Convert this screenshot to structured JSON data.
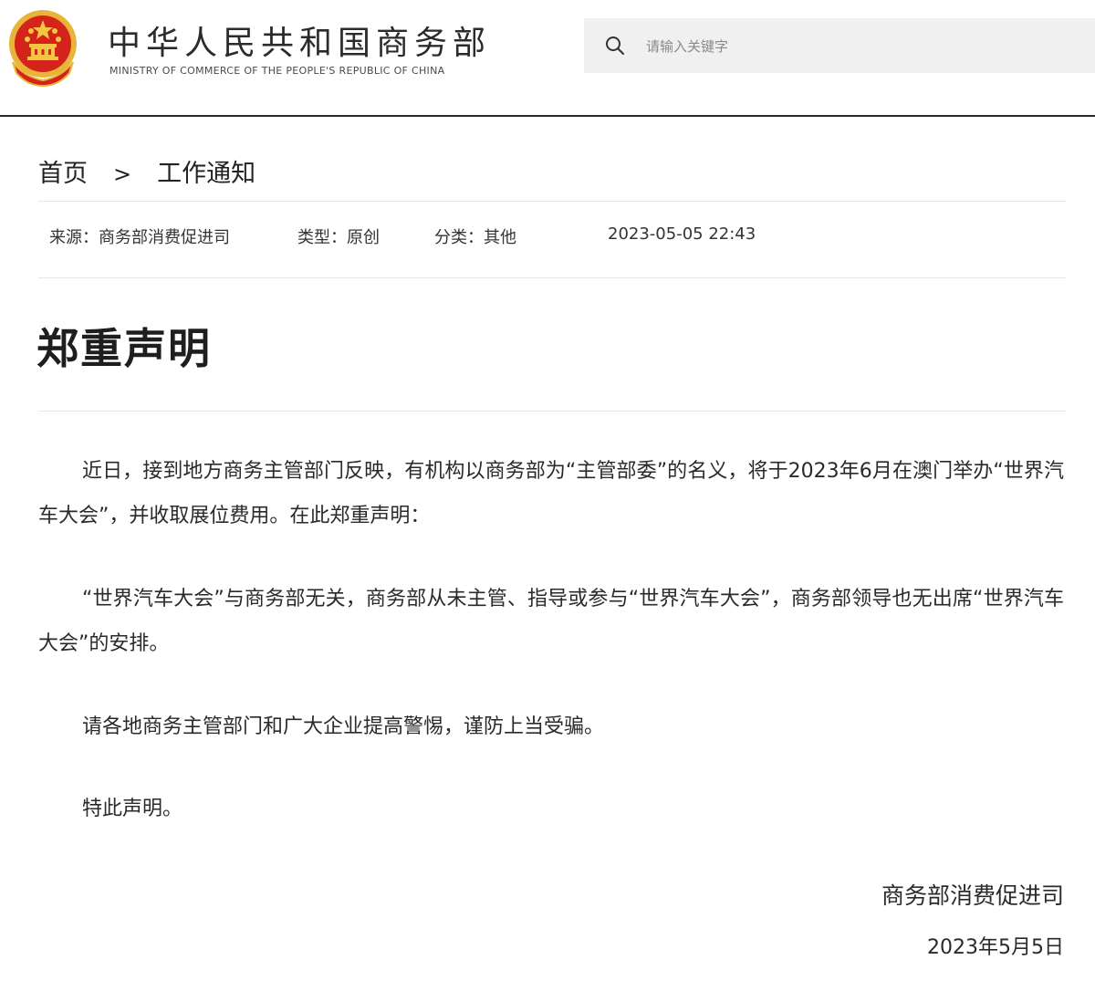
{
  "header": {
    "title": "中华人民共和国商务部",
    "subtitle": "MINISTRY OF COMMERCE OF THE PEOPLE'S REPUBLIC OF CHINA",
    "emblem_icon": "national-emblem-icon",
    "search": {
      "placeholder": "请输入关键字",
      "icon": "search-icon"
    }
  },
  "breadcrumb": {
    "home": "首页",
    "separator": ">",
    "current": "工作通知"
  },
  "meta": {
    "source": "来源：商务部消费促进司",
    "type": "类型：原创",
    "category": "分类：其他",
    "datetime": "2023-05-05 22:43"
  },
  "article": {
    "title": "郑重声明",
    "paragraphs": [
      "近日，接到地方商务主管部门反映，有机构以商务部为“主管部委”的名义，将于2023年6月在澳门举办“世界汽车大会”，并收取展位费用。在此郑重声明：",
      "“世界汽车大会”与商务部无关，商务部从未主管、指导或参与“世界汽车大会”，商务部领导也无出席“世界汽车大会”的安排。",
      "请各地商务主管部门和广大企业提高警惕，谨防上当受骗。",
      "特此声明。"
    ],
    "signature": "商务部消费促进司",
    "date": "2023年5月5日"
  },
  "colors": {
    "emblem_red": "#d3231b",
    "emblem_gold": "#e9b43a",
    "header_rule": "#2a2a2a",
    "search_bg": "#f0f0f0"
  }
}
